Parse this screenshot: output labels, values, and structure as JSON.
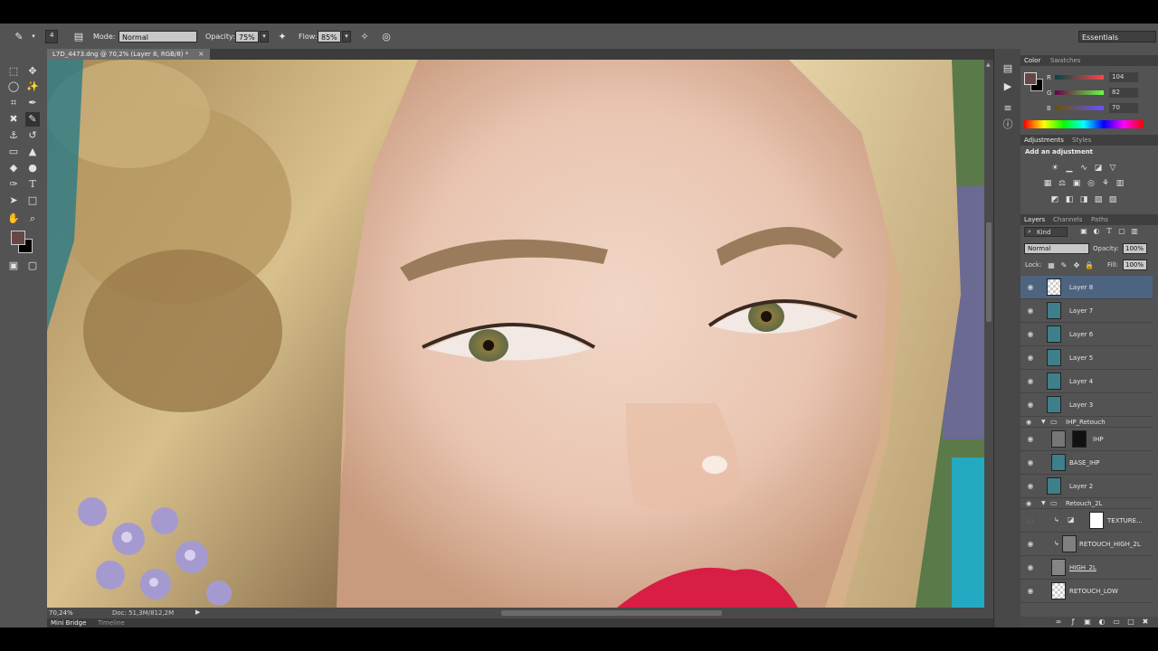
{
  "options_bar": {
    "brush_size": "4",
    "mode_label": "Mode:",
    "mode_value": "Normal",
    "opacity_label": "Opacity:",
    "opacity_value": "75%",
    "flow_label": "Flow:",
    "flow_value": "85%",
    "workspace": "Essentials"
  },
  "document": {
    "tab_title": "L7D_4473.dng @ 70,2% (Layer 8, RGB/8) *",
    "close_glyph": "×",
    "zoom": "70,24%",
    "doc_info": "Doc: 51,3M/812,2M"
  },
  "bottom_tabs": [
    "Mini Bridge",
    "Timeline"
  ],
  "color_panel": {
    "tabs": [
      "Color",
      "Swatches"
    ],
    "r_label": "R",
    "r_value": "104",
    "g_label": "G",
    "g_value": "82",
    "b_label": "B",
    "b_value": "70",
    "fg_color": "#684646",
    "bg_color": "#000000"
  },
  "adjustments_panel": {
    "tabs": [
      "Adjustments",
      "Styles"
    ],
    "heading": "Add an adjustment"
  },
  "layers_panel": {
    "tabs": [
      "Layers",
      "Channels",
      "Paths"
    ],
    "kind_label": "Kind",
    "blend_mode": "Normal",
    "opacity_label": "Opacity:",
    "opacity_value": "100%",
    "lock_label": "Lock:",
    "fill_label": "Fill:",
    "fill_value": "100%",
    "layers": [
      {
        "name": "Layer 8"
      },
      {
        "name": "Layer 7"
      },
      {
        "name": "Layer 6"
      },
      {
        "name": "Layer 5"
      },
      {
        "name": "Layer 4"
      },
      {
        "name": "Layer 3"
      },
      {
        "name": "IHP_Retouch"
      },
      {
        "name": "IHP"
      },
      {
        "name": "BASE_IHP"
      },
      {
        "name": "Layer 2"
      },
      {
        "name": "Retouch_2L"
      },
      {
        "name": "TEXTURE..."
      },
      {
        "name": "RETOUCH_HIGH_2L"
      },
      {
        "name": "HIGH_2L"
      },
      {
        "name": "RETOUCH_LOW"
      }
    ]
  }
}
